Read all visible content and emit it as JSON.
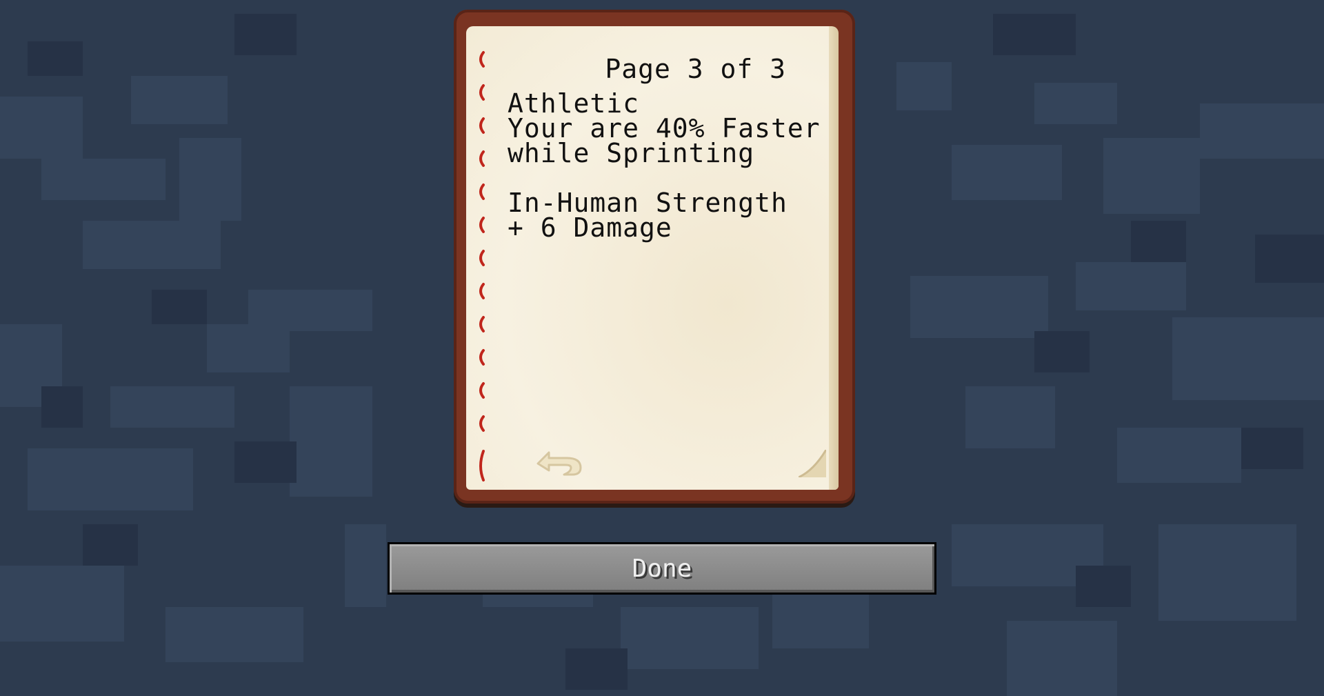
{
  "book": {
    "page_indicator": "Page 3 of 3",
    "lines": [
      "Athletic",
      "Your are 40% Faster",
      "while Sprinting",
      "",
      "In-Human Strength",
      "+ 6 Damage"
    ]
  },
  "buttons": {
    "done_label": "Done"
  },
  "icons": {
    "previous_page": "arrow-back-icon",
    "page_corner": "page-curl-icon"
  },
  "colors": {
    "background": "#2d3b4f",
    "book_cover": "#7a3422",
    "paper": "#f6efdc",
    "binding_thread": "#c0261c",
    "button": "#8c8c8c"
  }
}
